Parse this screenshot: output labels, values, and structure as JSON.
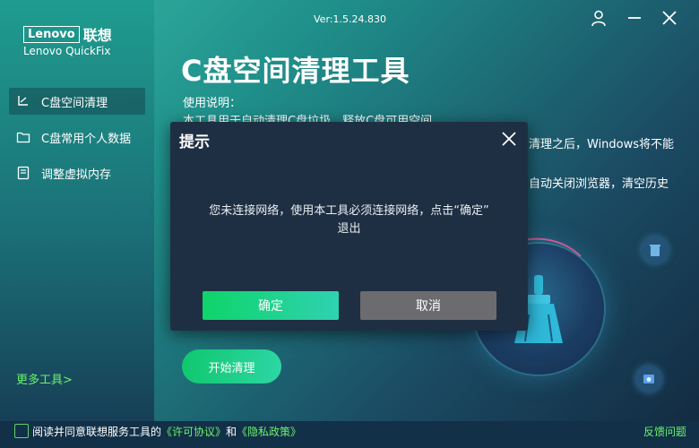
{
  "brand": {
    "logo_text": "Lenovo",
    "logo_cn": "联想",
    "product": "Lenovo QuickFix"
  },
  "titlebar": {
    "version": "Ver:1.5.24.830"
  },
  "sidebar": {
    "items": [
      {
        "label": "C盘空间清理",
        "icon": "broom-icon",
        "active": true
      },
      {
        "label": "C盘常用个人数据",
        "icon": "folder-icon",
        "active": false
      },
      {
        "label": "调整虚拟内存",
        "icon": "memory-icon",
        "active": false
      }
    ],
    "more_tools": "更多工具>"
  },
  "main": {
    "title": "C盘空间清理工具",
    "usage_label": "使用说明：",
    "usage_lines": [
      "本工具用于自动清理C盘垃圾，释放C盘可用空间。",
      "清理之后，Windows将不能",
      "自动关闭浏览器，清空历史"
    ],
    "start_button": "开始清理"
  },
  "dialog": {
    "title": "提示",
    "message_line1": "您未连接网络，使用本工具必须连接网络，点击“确定”",
    "message_line2": "退出",
    "ok_label": "确定",
    "cancel_label": "取消"
  },
  "footer": {
    "agree_prefix": "阅读并同意联想服务工具的",
    "license_link": "《许可协议》",
    "and_text": "和",
    "privacy_link": "《隐私政策》",
    "feedback": "反馈问题"
  },
  "colors": {
    "accent_green": "#10c86e",
    "link_green": "#6cf26c",
    "dialog_bg": "#1f2f43",
    "cancel_gray": "#6c6c70"
  }
}
